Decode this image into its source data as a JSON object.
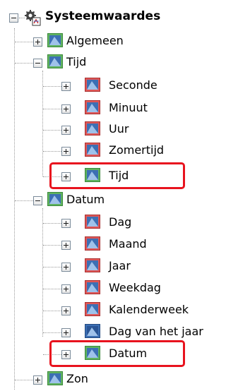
{
  "tree": {
    "root": {
      "label": "Systeemwaardes",
      "icon": "system-values-icon"
    },
    "algemeen": {
      "label": "Algemeen"
    },
    "tijd_group": {
      "label": "Tijd",
      "items": [
        "Seconde",
        "Minuut",
        "Uur",
        "Zomertijd",
        "Tijd"
      ]
    },
    "datum_group": {
      "label": "Datum",
      "items": [
        "Dag",
        "Maand",
        "Jaar",
        "Weekdag",
        "Kalenderweek",
        "Dag van het jaar",
        "Datum"
      ]
    },
    "zon": {
      "label": "Zon"
    }
  },
  "colors": {
    "highlight": "#e8131e",
    "icon_green": "#5fb35f",
    "icon_red": "#e05757",
    "icon_blue": "#3c6fb4"
  }
}
